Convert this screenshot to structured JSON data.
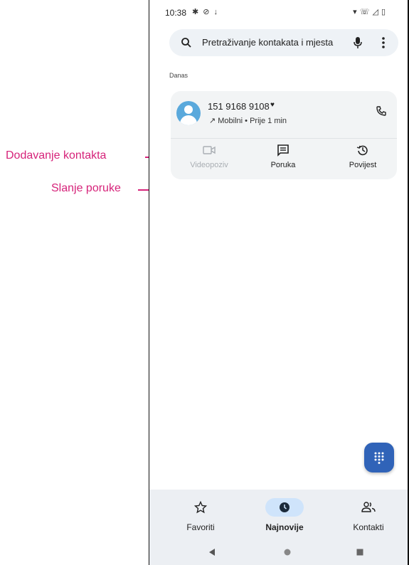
{
  "annotations": {
    "add_contact": "Dodavanje kontakta",
    "send_message": "Slanje poruke",
    "color": "#d6237a"
  },
  "status_bar": {
    "time": "10:38",
    "left_icons": [
      "settings-icon",
      "dnd-icon",
      "download-icon"
    ],
    "right_icons": [
      "wifi-icon",
      "call-signal-icon",
      "signal-icon",
      "battery-icon"
    ]
  },
  "search": {
    "placeholder": "Pretraživanje kontakata i mjesta"
  },
  "section": {
    "label": "Danas"
  },
  "call_entry": {
    "number": "151 9168 9108",
    "meta": "↗ Mobilni • Prije 1 min",
    "avatar_color": "#5aa9dc",
    "actions": [
      {
        "label": "Videopoziv",
        "icon": "video-icon",
        "enabled": false
      },
      {
        "label": "Poruka",
        "icon": "message-icon",
        "enabled": true
      },
      {
        "label": "Povijest",
        "icon": "history-icon",
        "enabled": true
      }
    ]
  },
  "fab": {
    "icon": "dialpad-icon",
    "color": "#3063b8"
  },
  "bottom_nav": {
    "items": [
      {
        "label": "Favoriti",
        "icon": "star-icon",
        "selected": false
      },
      {
        "label": "Najnovije",
        "icon": "clock-icon",
        "selected": true
      },
      {
        "label": "Kontakti",
        "icon": "people-icon",
        "selected": false
      }
    ]
  },
  "system_nav": [
    "back-icon",
    "home-icon",
    "recents-icon"
  ]
}
